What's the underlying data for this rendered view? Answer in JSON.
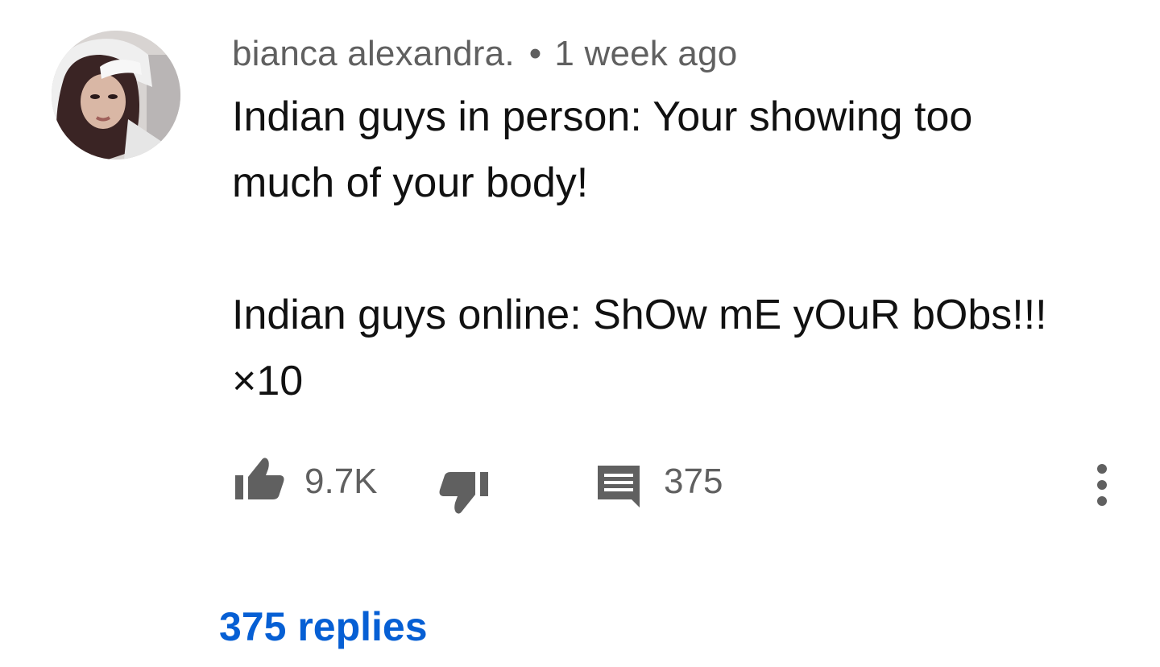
{
  "comment": {
    "author": "bianca alexandra.",
    "separator": "•",
    "timestamp": "1 week ago",
    "body_lines": [
      "Indian guys in person: Your showing too",
      "much of your body!",
      "",
      "Indian guys online: ShOw mE yOuR bObs!!!",
      "×10"
    ],
    "avatar_icon": "user-avatar"
  },
  "actions": {
    "like_icon": "thumbs-up-icon",
    "like_count": "9.7K",
    "dislike_icon": "thumbs-down-icon",
    "reply_icon": "comment-icon",
    "reply_count": "375",
    "more_icon": "more-vertical-icon"
  },
  "replies": {
    "label": "375 replies"
  },
  "colors": {
    "text_primary": "#111111",
    "text_secondary": "#606060",
    "link": "#065fd4"
  }
}
